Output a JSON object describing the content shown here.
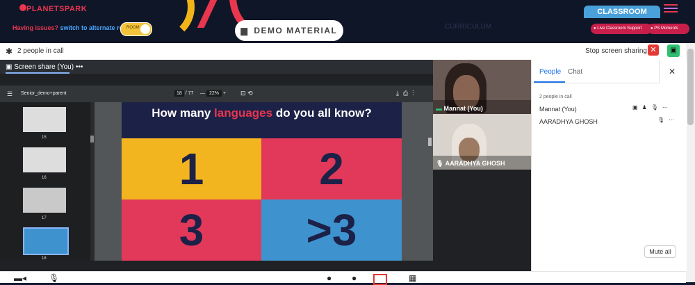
{
  "header": {
    "logo_text": "PLANETSPARK",
    "issue_text": "Having issues?",
    "alt_room_link": "switch to alternate room",
    "toggle_label": "ROOM",
    "demo_button_label": "DEMO MATERIAL",
    "curriculum_label": "CURRICULUM",
    "classroom_tab_label": "CLASSROOM",
    "live_support_label": "Live Classroom Support",
    "ps_moments_label": "PS Moments"
  },
  "callbar": {
    "people_in_call": "2 people in call",
    "stop_sharing_label": "Stop screen sharing"
  },
  "share": {
    "title": "Screen share (You)",
    "more": "•••"
  },
  "pdf": {
    "filename": "Senior_demo+parent",
    "page_current": "18",
    "page_total": "/ 77",
    "zoom": "22%",
    "minus": "—",
    "plus": "+"
  },
  "thumbnails": [
    {
      "label": "15"
    },
    {
      "label": "16"
    },
    {
      "label": "17"
    },
    {
      "label": "18"
    }
  ],
  "slide": {
    "title_part1": "How many ",
    "title_highlight": "languages",
    "title_part2": " do you all know?",
    "options": [
      "1",
      "2",
      "3",
      ">3"
    ]
  },
  "tiles": [
    {
      "name": "Mannat (You)"
    },
    {
      "name": "AARADHYA GHOSH"
    }
  ],
  "people_panel": {
    "tab_people": "People",
    "tab_chat": "Chat",
    "count_label": "2 people in call",
    "participants": [
      {
        "name": "Mannat (You)"
      },
      {
        "name": "AARADHYA GHOSH"
      }
    ],
    "mute_all_label": "Mute all"
  }
}
